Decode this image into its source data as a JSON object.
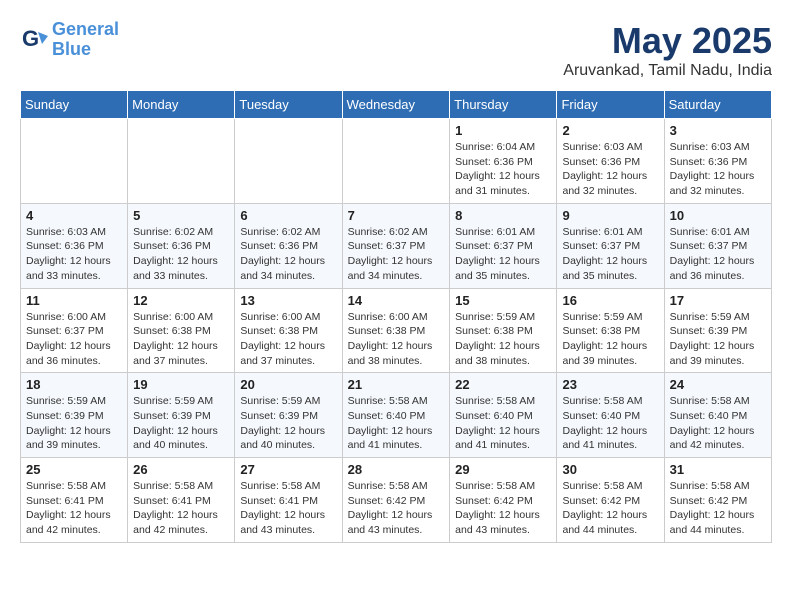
{
  "logo": {
    "line1": "General",
    "line2": "Blue"
  },
  "title": "May 2025",
  "location": "Aruvankad, Tamil Nadu, India",
  "headers": [
    "Sunday",
    "Monday",
    "Tuesday",
    "Wednesday",
    "Thursday",
    "Friday",
    "Saturday"
  ],
  "weeks": [
    [
      {
        "day": "",
        "info": ""
      },
      {
        "day": "",
        "info": ""
      },
      {
        "day": "",
        "info": ""
      },
      {
        "day": "",
        "info": ""
      },
      {
        "day": "1",
        "info": "Sunrise: 6:04 AM\nSunset: 6:36 PM\nDaylight: 12 hours and 31 minutes."
      },
      {
        "day": "2",
        "info": "Sunrise: 6:03 AM\nSunset: 6:36 PM\nDaylight: 12 hours and 32 minutes."
      },
      {
        "day": "3",
        "info": "Sunrise: 6:03 AM\nSunset: 6:36 PM\nDaylight: 12 hours and 32 minutes."
      }
    ],
    [
      {
        "day": "4",
        "info": "Sunrise: 6:03 AM\nSunset: 6:36 PM\nDaylight: 12 hours and 33 minutes."
      },
      {
        "day": "5",
        "info": "Sunrise: 6:02 AM\nSunset: 6:36 PM\nDaylight: 12 hours and 33 minutes."
      },
      {
        "day": "6",
        "info": "Sunrise: 6:02 AM\nSunset: 6:36 PM\nDaylight: 12 hours and 34 minutes."
      },
      {
        "day": "7",
        "info": "Sunrise: 6:02 AM\nSunset: 6:37 PM\nDaylight: 12 hours and 34 minutes."
      },
      {
        "day": "8",
        "info": "Sunrise: 6:01 AM\nSunset: 6:37 PM\nDaylight: 12 hours and 35 minutes."
      },
      {
        "day": "9",
        "info": "Sunrise: 6:01 AM\nSunset: 6:37 PM\nDaylight: 12 hours and 35 minutes."
      },
      {
        "day": "10",
        "info": "Sunrise: 6:01 AM\nSunset: 6:37 PM\nDaylight: 12 hours and 36 minutes."
      }
    ],
    [
      {
        "day": "11",
        "info": "Sunrise: 6:00 AM\nSunset: 6:37 PM\nDaylight: 12 hours and 36 minutes."
      },
      {
        "day": "12",
        "info": "Sunrise: 6:00 AM\nSunset: 6:38 PM\nDaylight: 12 hours and 37 minutes."
      },
      {
        "day": "13",
        "info": "Sunrise: 6:00 AM\nSunset: 6:38 PM\nDaylight: 12 hours and 37 minutes."
      },
      {
        "day": "14",
        "info": "Sunrise: 6:00 AM\nSunset: 6:38 PM\nDaylight: 12 hours and 38 minutes."
      },
      {
        "day": "15",
        "info": "Sunrise: 5:59 AM\nSunset: 6:38 PM\nDaylight: 12 hours and 38 minutes."
      },
      {
        "day": "16",
        "info": "Sunrise: 5:59 AM\nSunset: 6:38 PM\nDaylight: 12 hours and 39 minutes."
      },
      {
        "day": "17",
        "info": "Sunrise: 5:59 AM\nSunset: 6:39 PM\nDaylight: 12 hours and 39 minutes."
      }
    ],
    [
      {
        "day": "18",
        "info": "Sunrise: 5:59 AM\nSunset: 6:39 PM\nDaylight: 12 hours and 39 minutes."
      },
      {
        "day": "19",
        "info": "Sunrise: 5:59 AM\nSunset: 6:39 PM\nDaylight: 12 hours and 40 minutes."
      },
      {
        "day": "20",
        "info": "Sunrise: 5:59 AM\nSunset: 6:39 PM\nDaylight: 12 hours and 40 minutes."
      },
      {
        "day": "21",
        "info": "Sunrise: 5:58 AM\nSunset: 6:40 PM\nDaylight: 12 hours and 41 minutes."
      },
      {
        "day": "22",
        "info": "Sunrise: 5:58 AM\nSunset: 6:40 PM\nDaylight: 12 hours and 41 minutes."
      },
      {
        "day": "23",
        "info": "Sunrise: 5:58 AM\nSunset: 6:40 PM\nDaylight: 12 hours and 41 minutes."
      },
      {
        "day": "24",
        "info": "Sunrise: 5:58 AM\nSunset: 6:40 PM\nDaylight: 12 hours and 42 minutes."
      }
    ],
    [
      {
        "day": "25",
        "info": "Sunrise: 5:58 AM\nSunset: 6:41 PM\nDaylight: 12 hours and 42 minutes."
      },
      {
        "day": "26",
        "info": "Sunrise: 5:58 AM\nSunset: 6:41 PM\nDaylight: 12 hours and 42 minutes."
      },
      {
        "day": "27",
        "info": "Sunrise: 5:58 AM\nSunset: 6:41 PM\nDaylight: 12 hours and 43 minutes."
      },
      {
        "day": "28",
        "info": "Sunrise: 5:58 AM\nSunset: 6:42 PM\nDaylight: 12 hours and 43 minutes."
      },
      {
        "day": "29",
        "info": "Sunrise: 5:58 AM\nSunset: 6:42 PM\nDaylight: 12 hours and 43 minutes."
      },
      {
        "day": "30",
        "info": "Sunrise: 5:58 AM\nSunset: 6:42 PM\nDaylight: 12 hours and 44 minutes."
      },
      {
        "day": "31",
        "info": "Sunrise: 5:58 AM\nSunset: 6:42 PM\nDaylight: 12 hours and 44 minutes."
      }
    ]
  ]
}
